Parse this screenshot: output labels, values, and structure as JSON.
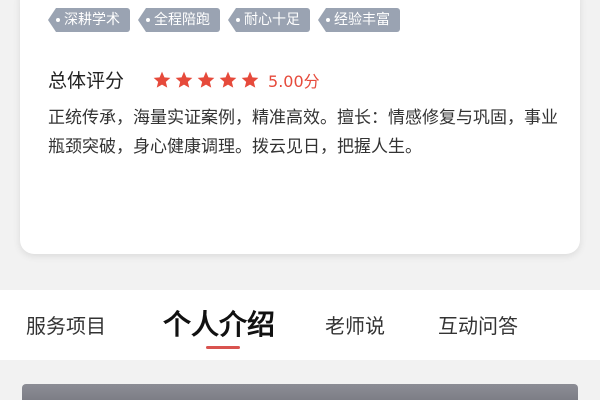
{
  "tags": [
    "深耕学术",
    "全程陪跑",
    "耐心十足",
    "经验丰富"
  ],
  "rating": {
    "label": "总体评分",
    "stars": 5,
    "value": "5.00分",
    "star_color": "#e64a3b"
  },
  "intro": "正统传承，海量实证案例，精准高效。擅长：情感修复与巩固，事业瓶颈突破，身心健康调理。拨云见日，把握人生。",
  "tabs": [
    {
      "label": "服务项目",
      "active": false
    },
    {
      "label": "个人介绍",
      "active": true
    },
    {
      "label": "老师说",
      "active": false
    },
    {
      "label": "互动问答",
      "active": false
    }
  ],
  "colors": {
    "accent": "#d9534f",
    "tag_bg": "#9aa3b2"
  }
}
